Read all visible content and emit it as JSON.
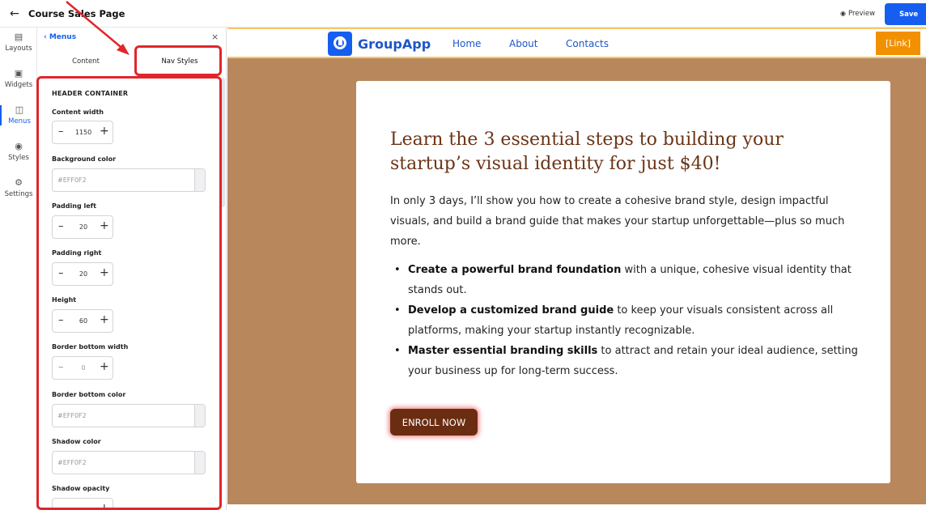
{
  "topbar": {
    "back_icon": "arrow-left-icon",
    "title": "Course Sales Page",
    "preview_label": "Preview",
    "save_label": "Save"
  },
  "rail": {
    "items": [
      {
        "label": "Layouts",
        "icon": "layouts-icon"
      },
      {
        "label": "Widgets",
        "icon": "widgets-icon"
      },
      {
        "label": "Menus",
        "icon": "menus-icon",
        "active": true
      },
      {
        "label": "Styles",
        "icon": "palette-icon"
      },
      {
        "label": "Settings",
        "icon": "gear-icon"
      }
    ]
  },
  "panel": {
    "back_label": "Menus",
    "tabs": [
      {
        "label": "Content"
      },
      {
        "label": "Nav Styles",
        "active": true
      }
    ],
    "section_title": "HEADER CONTAINER",
    "fields": {
      "content_width": {
        "label": "Content width",
        "value": "1150"
      },
      "background_color": {
        "label": "Background color",
        "value": "#EFF0F2"
      },
      "padding_left": {
        "label": "Padding left",
        "value": "20"
      },
      "padding_right": {
        "label": "Padding right",
        "value": "20"
      },
      "height": {
        "label": "Height",
        "value": "60"
      },
      "border_bottom_width": {
        "label": "Border bottom width",
        "value": "0"
      },
      "border_bottom_color": {
        "label": "Border bottom color",
        "value": "#EFF0F2"
      },
      "shadow_color": {
        "label": "Shadow color",
        "value": "#EFF0F2"
      },
      "shadow_opacity": {
        "label": "Shadow opacity"
      }
    }
  },
  "canvas": {
    "brand": "GroupApp",
    "nav_links": [
      "Home",
      "About",
      "Contacts"
    ],
    "link_button": "[Link]",
    "headline": "Learn the 3 essential steps to building your startup’s visual identity for just $40!",
    "intro": "In only 3 days, I’ll show you how to create a cohesive brand style, design impactful visuals, and build a brand guide that makes your startup unforgettable—plus so much more.",
    "bullets": [
      {
        "bold": "Create a powerful brand foundation",
        "rest": " with a unique, cohesive visual identity that stands out."
      },
      {
        "bold": "Develop a customized brand guide",
        "rest": " to keep your visuals consistent across all platforms, making your startup instantly recognizable."
      },
      {
        "bold": "Master essential branding skills",
        "rest": " to attract and retain your ideal audience, setting your business up for long-term success."
      }
    ],
    "cta_label": "ENROLL NOW"
  },
  "colors": {
    "accent": "#155eef",
    "hero_bg": "#b8875c",
    "headline": "#6b3416",
    "cta_bg": "#6b2d12",
    "link_button_bg": "#f29100",
    "annotation": "#e0262c"
  }
}
